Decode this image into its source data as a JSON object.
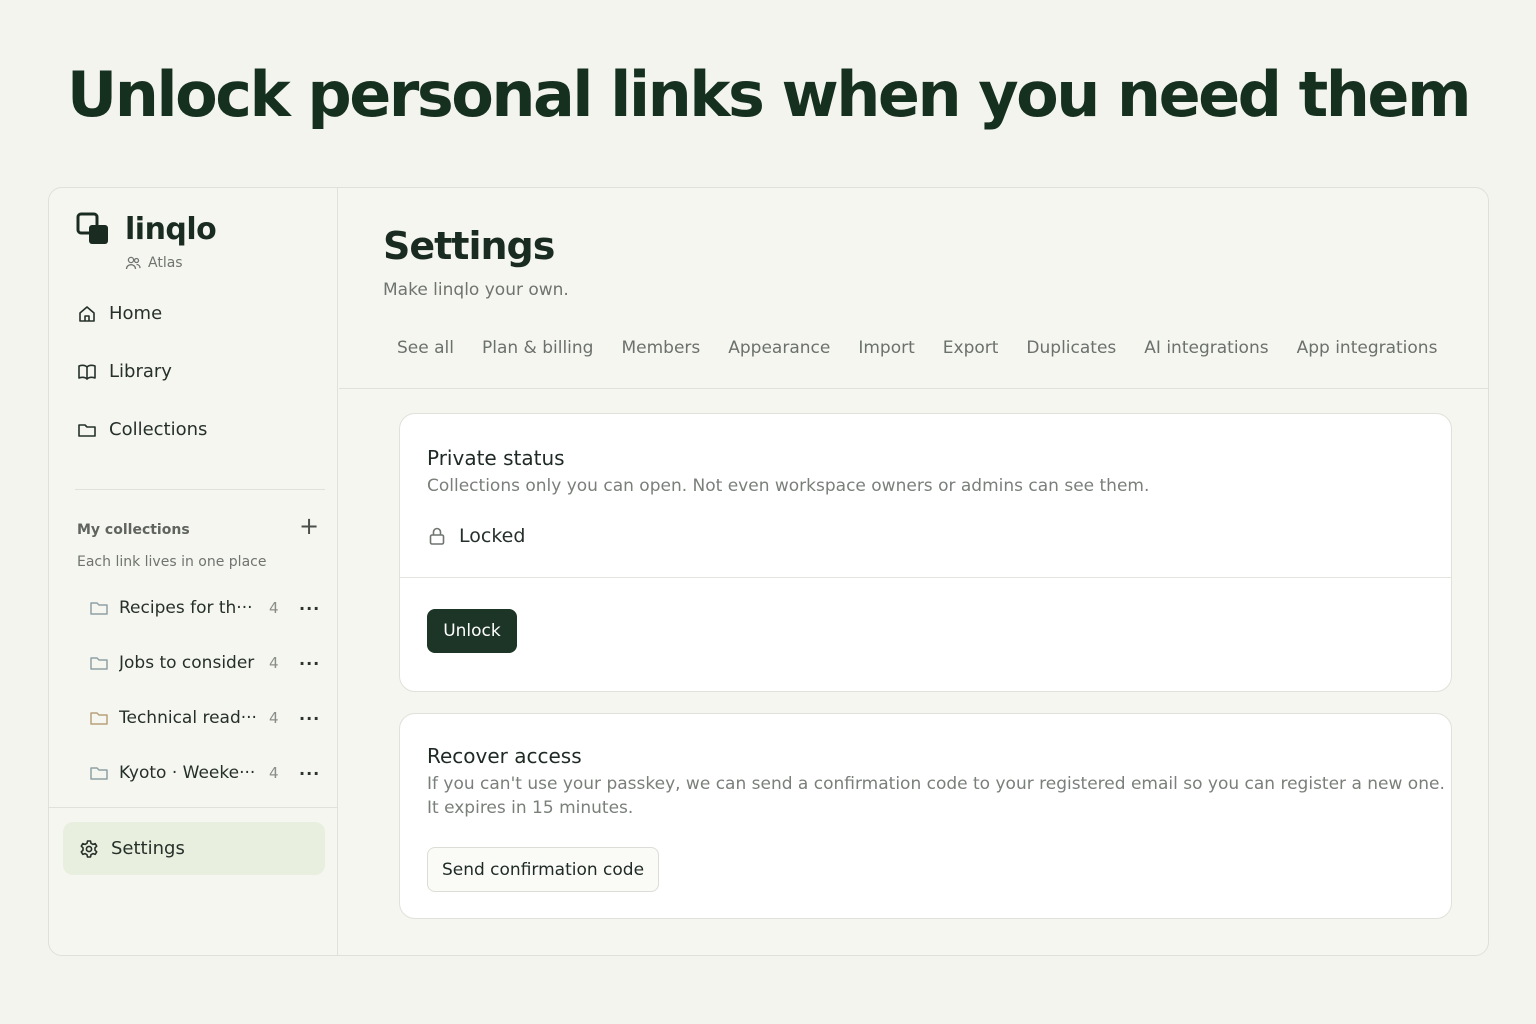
{
  "headline": "Unlock personal links when you need them",
  "app": {
    "brand": "linqlo",
    "workspace": "Atlas"
  },
  "sidebar": {
    "nav": [
      {
        "label": "Home",
        "icon": "home-icon"
      },
      {
        "label": "Library",
        "icon": "book-icon"
      },
      {
        "label": "Collections",
        "icon": "folder-icon"
      }
    ],
    "my_collections": {
      "title": "My collections",
      "subtitle": "Each link lives in one place",
      "add_label": "+",
      "items": [
        {
          "name": "Recipes for th···",
          "count": "4",
          "more": "···",
          "color": "#8fa0a6"
        },
        {
          "name": "Jobs to consider",
          "count": "4",
          "more": "···",
          "color": "#8fa0a6"
        },
        {
          "name": "Technical read···",
          "count": "4",
          "more": "···",
          "color": "#b8a07a"
        },
        {
          "name": "Kyoto · Weeke···",
          "count": "4",
          "more": "···",
          "color": "#8fa0a6"
        }
      ]
    },
    "settings_label": "Settings"
  },
  "main": {
    "title": "Settings",
    "subtitle": "Make linqlo your own.",
    "tabs": [
      "See all",
      "Plan & billing",
      "Members",
      "Appearance",
      "Import",
      "Export",
      "Duplicates",
      "AI integrations",
      "App integrations"
    ]
  },
  "private_card": {
    "title": "Private status",
    "description": "Collections only you can open. Not even workspace owners or admins can see them.",
    "status": "Locked",
    "button": "Unlock"
  },
  "recover_card": {
    "title": "Recover access",
    "description_line1": "If you can't use your passkey, we can send a confirmation code to your registered email so you can register a new one.",
    "description_line2": "It expires in 15 minutes.",
    "button": "Send confirmation code"
  },
  "colors": {
    "accent": "#1c3527",
    "active_nav_bg": "#e9efdf",
    "background": "#f4f4ef"
  }
}
